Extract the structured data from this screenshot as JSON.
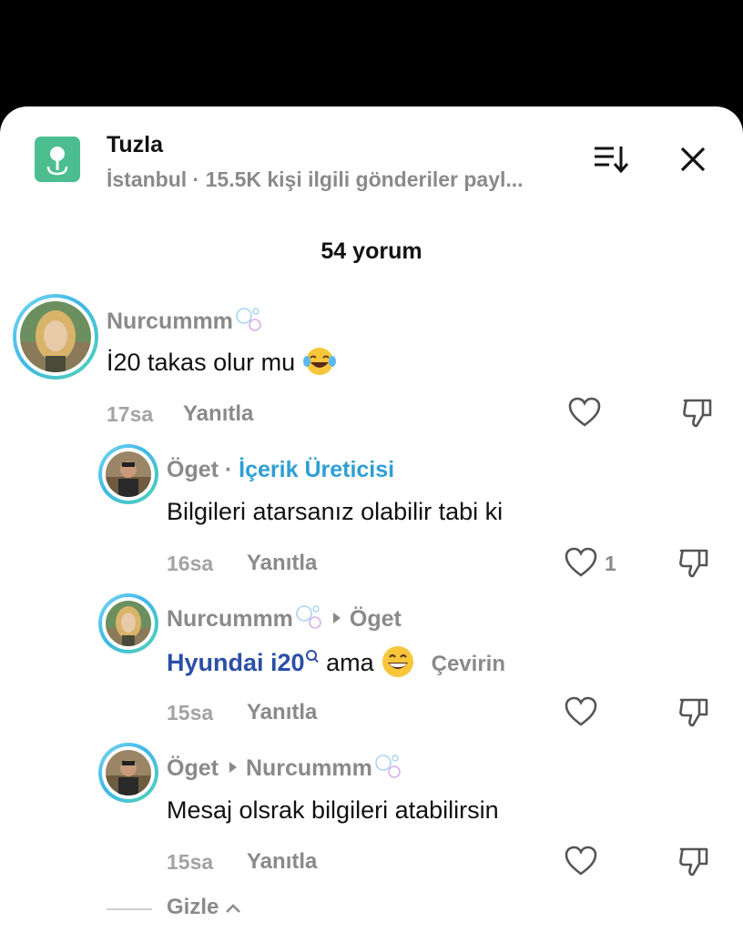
{
  "header": {
    "title": "Tuzla",
    "subtitle": "İstanbul · 15.5K kişi ilgili gönderiler payl..."
  },
  "comments_count": "54 yorum",
  "comments": [
    {
      "username": "Nurcummm",
      "text": "İ20 takas olur mu",
      "time": "17sa",
      "reply_label": "Yanıtla"
    }
  ],
  "replies": [
    {
      "username": "Öget",
      "badge": "İçerik Üreticisi",
      "text": "Bilgileri atarsanız olabilir tabi ki",
      "time": "16sa",
      "reply_label": "Yanıtla",
      "likes": "1"
    },
    {
      "username": "Nurcummm",
      "reply_to": "Öget",
      "link_text": "Hyundai i20",
      "text": "ama",
      "translate_label": "Çevirin",
      "time": "15sa",
      "reply_label": "Yanıtla"
    },
    {
      "username": "Öget",
      "reply_to": "Nurcummm",
      "text": "Mesaj olsrak bilgileri atabilirsin",
      "time": "15sa",
      "reply_label": "Yanıtla"
    }
  ],
  "hide_label": "Gizle",
  "colors": {
    "location_badge": "#4cbd8e",
    "creator_badge": "#2e9fd3",
    "link": "#2b4fa7",
    "muted": "#8a8a8a"
  },
  "icons": [
    "location-pin-icon",
    "sort-icon",
    "close-icon",
    "heart-icon",
    "dislike-icon",
    "bubbles-icon",
    "search-icon",
    "chevron-up-icon"
  ]
}
